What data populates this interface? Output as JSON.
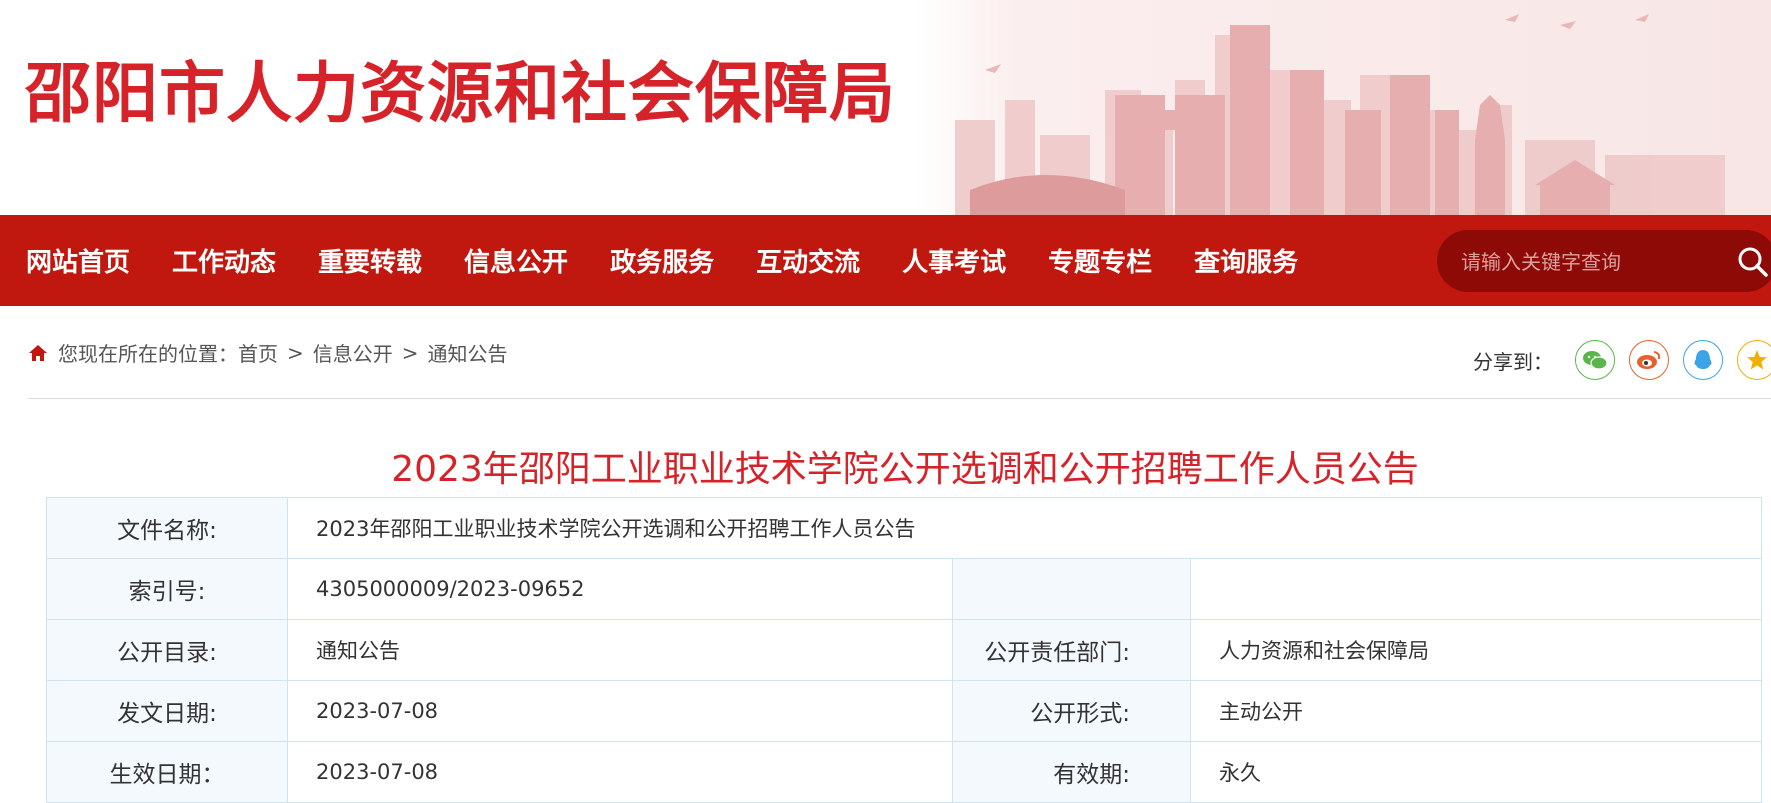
{
  "header": {
    "site_title": "邵阳市人力资源和社会保障局"
  },
  "nav": {
    "items": [
      "网站首页",
      "工作动态",
      "重要转载",
      "信息公开",
      "政务服务",
      "互动交流",
      "人事考试",
      "专题专栏",
      "查询服务"
    ],
    "search_placeholder": "请输入关键字查询"
  },
  "breadcrumb": {
    "prefix": "您现在所在的位置：",
    "items": [
      "首页",
      "信息公开",
      "通知公告"
    ],
    "separator": ">"
  },
  "share": {
    "label": "分享到：",
    "targets": [
      "wechat-icon",
      "weibo-icon",
      "qq-icon",
      "qzone-icon"
    ]
  },
  "article": {
    "title": "2023年邵阳工业职业技术学院公开选调和公开招聘工作人员公告"
  },
  "info_table": {
    "file_name_label": "文件名称:",
    "file_name": "2023年邵阳工业职业技术学院公开选调和公开招聘工作人员公告",
    "index_label": "索引号:",
    "index_value": "4305000009/2023-09652",
    "catalog_label": "公开目录:",
    "catalog_value": "通知公告",
    "dept_label": "公开责任部门:",
    "dept_value": "人力资源和社会保障局",
    "issue_date_label": "发文日期:",
    "issue_date": "2023-07-08",
    "form_label": "公开形式:",
    "form_value": "主动公开",
    "effective_label": "生效日期：",
    "effective_date": "2023-07-08",
    "validity_label": "有效期:",
    "validity_value": "永久"
  },
  "colors": {
    "brand_red": "#c0170f",
    "title_red": "#d6232a",
    "table_border": "#cfe3f1",
    "label_bg": "#f4f9fd"
  }
}
